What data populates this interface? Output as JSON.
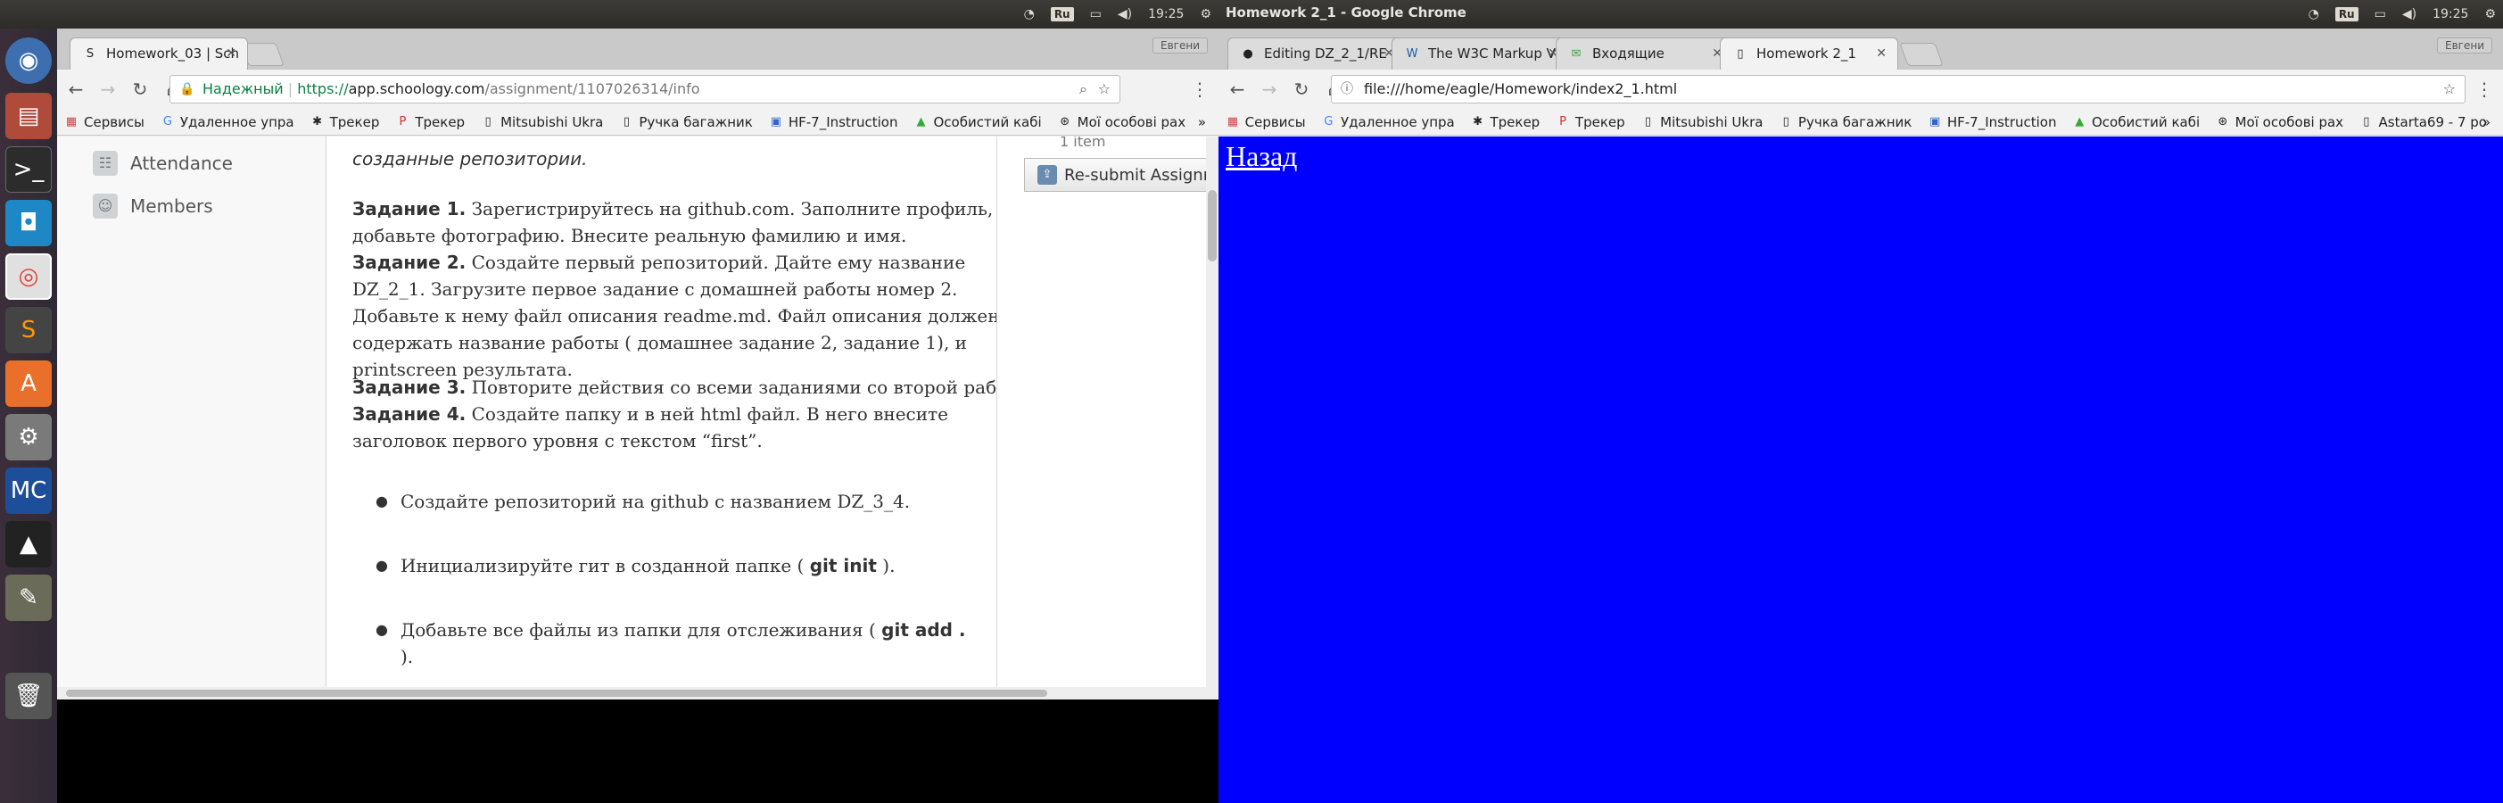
{
  "left_screen": {
    "topbar": {
      "keyboard": "Ru",
      "time": "19:25"
    },
    "launcher_icons": [
      "ubuntu-dash-icon",
      "files-icon",
      "terminal-icon",
      "app-icon",
      "chrome-icon",
      "sublime-icon",
      "software-center-icon",
      "settings-icon",
      "mc-icon",
      "inkscape-icon",
      "gimp-icon",
      "trash-icon"
    ],
    "browser": {
      "profile": "Евгени",
      "tabs": [
        {
          "title": "Homework_03 | Sch",
          "active": true
        }
      ],
      "url": {
        "secure_label": "Надежный",
        "scheme": "https://",
        "host": "app.schoology.com",
        "path": "/assignment/1107026314/info"
      },
      "bookmarks": [
        "Сервисы",
        "Удаленное упра",
        "Трекер",
        "Трекер",
        "Mitsubishi Ukra",
        "Ручка багажник",
        "HF-7_Instruction",
        "Особистий кабі",
        "Мої особові рах"
      ],
      "bookmarks_more": "»"
    },
    "page": {
      "nav": [
        {
          "label": "Attendance"
        },
        {
          "label": "Members"
        }
      ],
      "intro_tail": "созданные репозитории.",
      "task1_label": "Задание 1.",
      "task1_text": "Зарегистрируйтесь на github.com. Заполните профиль, добавьте фотографию. Внесите реальную фамилию и имя.",
      "task2_label": "Задание 2.",
      "task2_text": "Создайте первый репозиторий. Дайте ему название DZ_2_1. Загрузите первое задание с домашней работы номер 2. Добавьте к нему файл описания readme.md. Файл описания должен содержать название работы ( домашнее задание 2, задание 1), и printscreen результата.",
      "task3_label": "Задание 3.",
      "task3_text": "Повторите действия со всеми заданиями со второй работы.",
      "task4_label": "Задание 4.",
      "task4_text": "Создайте папку и в ней html файл. В него внесите заголовок первого уровня с текстом “first”.",
      "bullet1": "Создайте репозиторий на github с названием DZ_3_4.",
      "bullet2_pre": "Инициализируйте гит в созданной папке ( ",
      "bullet2_code": "git init",
      "bullet2_post": " ).",
      "bullet3_pre": "Добавьте все файлы из папки для отслеживания ( ",
      "bullet3_code": "git add .",
      "bullet3_post": ").",
      "one_item": "1 item",
      "resubmit": "Re-submit Assignm"
    }
  },
  "right_screen": {
    "window_title": "Homework 2_1 - Google Chrome",
    "topbar": {
      "keyboard": "Ru",
      "time": "19:25"
    },
    "browser": {
      "profile": "Евгени",
      "tabs": [
        {
          "title": "Editing DZ_2_1/RE",
          "icon": "github-icon"
        },
        {
          "title": "The W3C Markup V",
          "icon": "w3c-icon"
        },
        {
          "title": "Входящие",
          "icon": "mail-icon"
        },
        {
          "title": "Homework 2_1",
          "icon": "page-icon",
          "active": true
        }
      ],
      "url": "file:///home/eagle/Homework/index2_1.html",
      "bookmarks": [
        "Сервисы",
        "Удаленное упра",
        "Трекер",
        "Трекер",
        "Mitsubishi Ukra",
        "Ручка багажник",
        "HF-7_Instruction",
        "Особистий кабі",
        "Мої особові рах",
        "Astarta69 - 7 ро"
      ],
      "bookmarks_more": "»"
    },
    "page": {
      "background": "#0000ff",
      "link": "Назад"
    }
  }
}
